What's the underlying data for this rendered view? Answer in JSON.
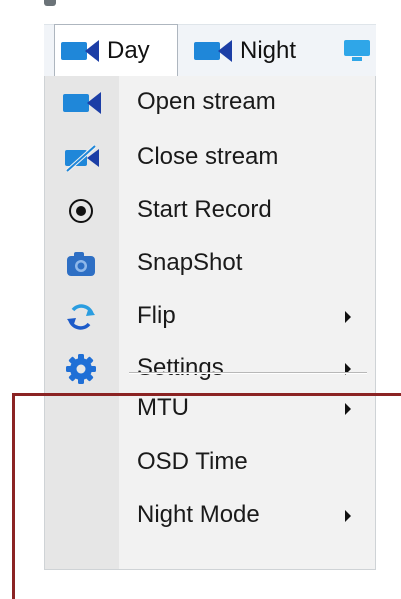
{
  "tabs": [
    {
      "label": "Day",
      "icon": "video-camera-icon",
      "active": true
    },
    {
      "label": "Night",
      "icon": "video-camera-icon",
      "active": false
    },
    {
      "label": "",
      "icon": "monitor-icon",
      "active": false
    }
  ],
  "menu": {
    "items": [
      {
        "label": "Open stream",
        "icon": "video-camera-icon"
      },
      {
        "label": "Close stream",
        "icon": "video-camera-off-icon"
      },
      {
        "label": "Start Record",
        "icon": "record-icon"
      },
      {
        "label": "SnapShot",
        "icon": "camera-icon"
      },
      {
        "label": "Flip",
        "icon": "flip-arrows-icon",
        "submenu": true
      },
      {
        "label": "Settings",
        "icon": "gear-icon",
        "submenu": true
      },
      {
        "label": "MTU",
        "submenu": true
      },
      {
        "label": "OSD Time"
      },
      {
        "label": "Night Mode",
        "submenu": true
      }
    ]
  },
  "colors": {
    "accent": "#1f87d9",
    "accent_dark": "#1c3ea6",
    "annotation": "#8b2323",
    "menu_bg": "#f2f2f2"
  }
}
